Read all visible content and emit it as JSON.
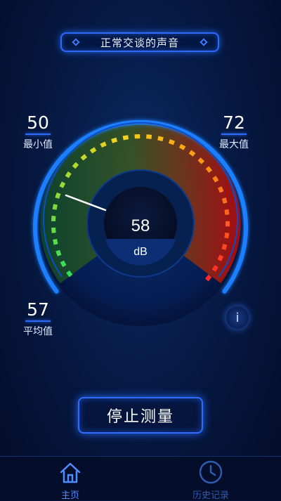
{
  "banner": {
    "text": "正常交谈的声音"
  },
  "stats": {
    "min": {
      "value": "50",
      "label": "最小值"
    },
    "max": {
      "value": "72",
      "label": "最大值"
    },
    "avg": {
      "value": "57",
      "label": "平均值"
    }
  },
  "gauge": {
    "value": "58",
    "unit": "dB"
  },
  "info": {
    "label": "i"
  },
  "stop_button": {
    "label": "停止测量"
  },
  "nav": {
    "home": {
      "label": "主页"
    },
    "history": {
      "label": "历史记录"
    }
  },
  "colors": {
    "accent": "#2f6bff",
    "low": "#31e05a",
    "mid": "#f6d21a",
    "high": "#ff2a2a"
  }
}
